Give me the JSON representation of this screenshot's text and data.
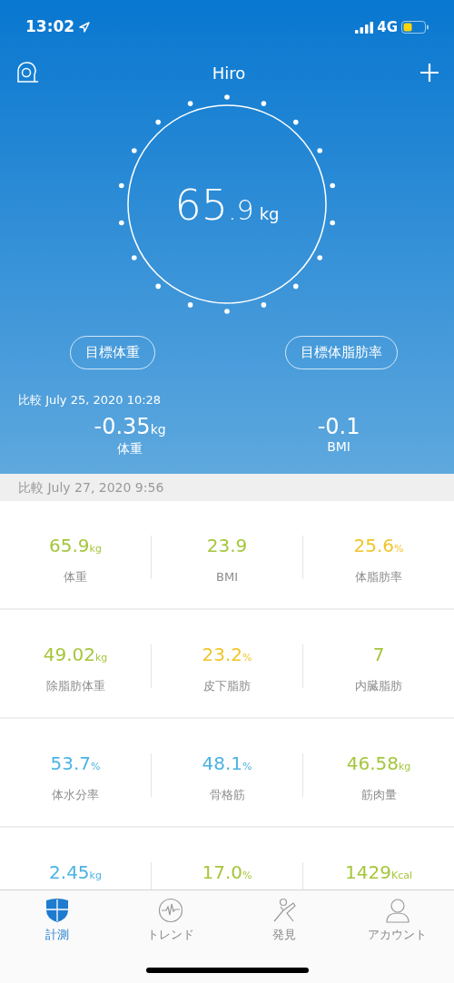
{
  "status_bar": {
    "time": "13:02",
    "network": "4G"
  },
  "header": {
    "title": "Hiro"
  },
  "weight": {
    "integer": "65",
    "fraction": ".9",
    "unit": "kg"
  },
  "goal_buttons": [
    "目標体重",
    "目標体脂肪率"
  ],
  "comparison": {
    "label": "比較 July 25, 2020 10:28",
    "deltas": [
      {
        "value": "-0.35",
        "unit": "kg",
        "label": "体重"
      },
      {
        "value": "-0.1",
        "label": "BMI"
      }
    ]
  },
  "section_header": "比較 July 27, 2020 9:56",
  "metric_rows": [
    [
      {
        "value": "65.9",
        "unit": "kg",
        "label": "体重",
        "color": "#a5c63b"
      },
      {
        "value": "23.9",
        "label": "BMI",
        "color": "#a5c63b"
      },
      {
        "value": "25.6",
        "unit": "%",
        "label": "体脂肪率",
        "color": "#f0c52a"
      }
    ],
    [
      {
        "value": "49.02",
        "unit": "kg",
        "label": "除脂肪体重",
        "color": "#a5c63b"
      },
      {
        "value": "23.2",
        "unit": "%",
        "label": "皮下脂肪",
        "color": "#f0c52a"
      },
      {
        "value": "7",
        "label": "内臓脂肪",
        "color": "#a5c63b"
      }
    ],
    [
      {
        "value": "53.7",
        "unit": "%",
        "label": "体水分率",
        "color": "#4bb3e3"
      },
      {
        "value": "48.1",
        "unit": "%",
        "label": "骨格筋",
        "color": "#4bb3e3"
      },
      {
        "value": "46.58",
        "unit": "kg",
        "label": "筋肉量",
        "color": "#a5c63b"
      }
    ],
    [
      {
        "value": "2.45",
        "unit": "kg",
        "color": "#4bb3e3"
      },
      {
        "value": "17.0",
        "unit": "%",
        "color": "#a5c63b"
      },
      {
        "value": "1429",
        "unit": "Kcal",
        "color": "#a5c63b"
      }
    ]
  ],
  "tabs": [
    {
      "label": "計測",
      "kind": "measure",
      "selected": true
    },
    {
      "label": "トレンド",
      "kind": "trend",
      "selected": false
    },
    {
      "label": "発見",
      "kind": "discover",
      "selected": false
    },
    {
      "label": "アカウント",
      "kind": "account",
      "selected": false
    }
  ]
}
